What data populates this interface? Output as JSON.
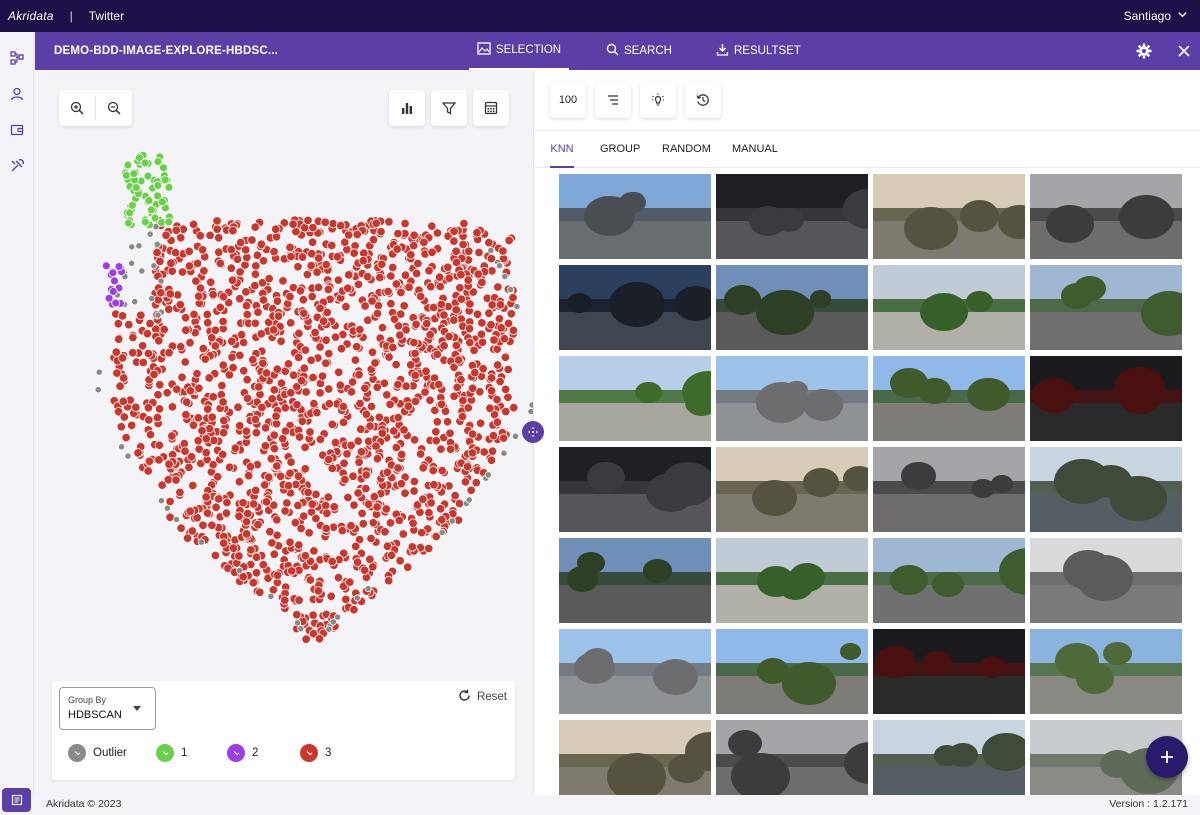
{
  "topbar": {
    "brand": "Akridata",
    "separator": "|",
    "workspace": "Twitter",
    "user": "Santiago"
  },
  "header": {
    "dataset": "DEMO-BDD-IMAGE-EXPLORE-HBDSC...",
    "tabs": [
      {
        "label": "SELECTION",
        "icon": "image-icon",
        "active": true
      },
      {
        "label": "SEARCH",
        "icon": "search-icon",
        "active": false
      },
      {
        "label": "RESULTSET",
        "icon": "download-icon",
        "active": false
      }
    ]
  },
  "left_rail": {
    "items": [
      "cluster-icon",
      "user-icon",
      "wallet-icon",
      "tools-icon"
    ],
    "bottom": "book-icon"
  },
  "plot_toolbar": {
    "zoom": [
      "zoom-in-icon",
      "zoom-out-icon"
    ],
    "tools": [
      "bar-chart-icon",
      "filter-icon",
      "calculator-icon"
    ]
  },
  "legend": {
    "group_by_label": "Group By",
    "group_by_value": "HDBSCAN",
    "reset_label": "Reset",
    "items": [
      {
        "label": "Outlier",
        "color": "#8a8a8a"
      },
      {
        "label": "1",
        "color": "#6ad04a"
      },
      {
        "label": "2",
        "color": "#9b3fe0"
      },
      {
        "label": "3",
        "color": "#c9382e"
      }
    ]
  },
  "results_toolbar": {
    "count": "100",
    "icons": [
      "sort-lines-icon",
      "lightbulb-icon",
      "history-icon"
    ]
  },
  "sampling_tabs": [
    {
      "label": "KNN",
      "active": true
    },
    {
      "label": "GROUP",
      "active": false
    },
    {
      "label": "RANDOM",
      "active": false
    },
    {
      "label": "MANUAL",
      "active": false
    }
  ],
  "footer": {
    "copyright": "Akridata © 2023",
    "version": "Version : 1.2.171"
  }
}
